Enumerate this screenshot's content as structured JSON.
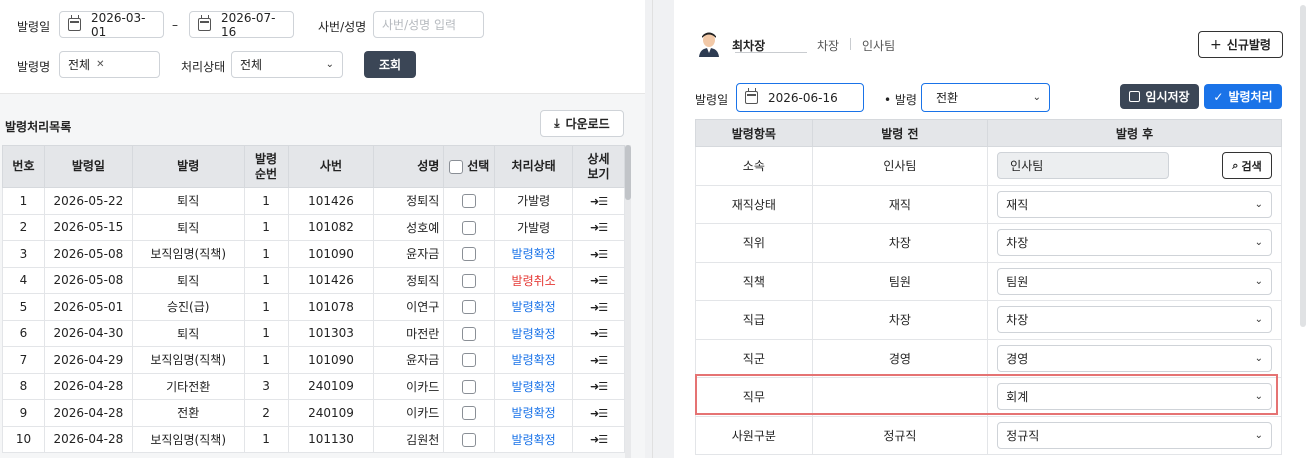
{
  "filter": {
    "date_label": "발령일",
    "date_from": "2026-03-01",
    "date_sep": "–",
    "date_to": "2026-07-16",
    "emp_label": "사번/성명",
    "emp_placeholder": "사번/성명 입력",
    "type_label": "발령명",
    "type_value": "전체",
    "type_clear": "✕",
    "status_label": "처리상태",
    "status_value": "전체",
    "search_button": "조회"
  },
  "list": {
    "title": "발령처리목록",
    "download_button": "다운로드",
    "headers": {
      "no": "번호",
      "date": "발령일",
      "type": "발령",
      "seq_1": "발령",
      "seq_2": "순번",
      "emp_no": "사번",
      "name": "성명",
      "select": "선택",
      "status": "처리상태",
      "detail_1": "상세",
      "detail_2": "보기"
    },
    "rows": [
      {
        "no": "1",
        "date": "2026-05-22",
        "type": "퇴직",
        "seq": "1",
        "emp_no": "101426",
        "name": "정퇴직",
        "status": "가발령",
        "status_kind": "temp"
      },
      {
        "no": "2",
        "date": "2026-05-15",
        "type": "퇴직",
        "seq": "1",
        "emp_no": "101082",
        "name": "성호예",
        "status": "가발령",
        "status_kind": "temp"
      },
      {
        "no": "3",
        "date": "2026-05-08",
        "type": "보직임명(직책)",
        "seq": "1",
        "emp_no": "101090",
        "name": "윤자금",
        "status": "발령확정",
        "status_kind": "confirm"
      },
      {
        "no": "4",
        "date": "2026-05-08",
        "type": "퇴직",
        "seq": "1",
        "emp_no": "101426",
        "name": "정퇴직",
        "status": "발령취소",
        "status_kind": "cancel"
      },
      {
        "no": "5",
        "date": "2026-05-01",
        "type": "승진(급)",
        "seq": "1",
        "emp_no": "101078",
        "name": "이연구",
        "status": "발령확정",
        "status_kind": "confirm"
      },
      {
        "no": "6",
        "date": "2026-04-30",
        "type": "퇴직",
        "seq": "1",
        "emp_no": "101303",
        "name": "마전란",
        "status": "발령확정",
        "status_kind": "confirm"
      },
      {
        "no": "7",
        "date": "2026-04-29",
        "type": "보직임명(직책)",
        "seq": "1",
        "emp_no": "101090",
        "name": "윤자금",
        "status": "발령확정",
        "status_kind": "confirm"
      },
      {
        "no": "8",
        "date": "2026-04-28",
        "type": "기타전환",
        "seq": "3",
        "emp_no": "240109",
        "name": "이카드",
        "status": "발령확정",
        "status_kind": "confirm"
      },
      {
        "no": "9",
        "date": "2026-04-28",
        "type": "전환",
        "seq": "2",
        "emp_no": "240109",
        "name": "이카드",
        "status": "발령확정",
        "status_kind": "confirm"
      },
      {
        "no": "10",
        "date": "2026-04-28",
        "type": "보직임명(직책)",
        "seq": "1",
        "emp_no": "101130",
        "name": "김원천",
        "status": "발령확정",
        "status_kind": "confirm"
      }
    ]
  },
  "detail": {
    "employee_name": "최차장",
    "employee_rank": "차장",
    "employee_dept": "인사팀",
    "new_button": "신규발령",
    "date_label": "발령일",
    "date_value": "2026-06-16",
    "type_label": "• 발령",
    "type_value": "전환",
    "save_button": "임시저장",
    "process_button": "발령처리",
    "headers": {
      "item": "발령항목",
      "before": "발령 전",
      "after": "발령 후"
    },
    "search_button": "검색",
    "rows": [
      {
        "item": "소속",
        "before": "인사팀",
        "after": "인사팀",
        "kind": "search"
      },
      {
        "item": "재직상태",
        "before": "재직",
        "after": "재직",
        "kind": "select"
      },
      {
        "item": "직위",
        "before": "차장",
        "after": "차장",
        "kind": "select"
      },
      {
        "item": "직책",
        "before": "팀원",
        "after": "팀원",
        "kind": "select"
      },
      {
        "item": "직급",
        "before": "차장",
        "after": "차장",
        "kind": "select"
      },
      {
        "item": "직군",
        "before": "경영",
        "after": "경영",
        "kind": "select"
      },
      {
        "item": "직무",
        "before": "",
        "after": "회계",
        "kind": "select"
      },
      {
        "item": "사원구분",
        "before": "정규직",
        "after": "정규직",
        "kind": "select"
      }
    ]
  }
}
